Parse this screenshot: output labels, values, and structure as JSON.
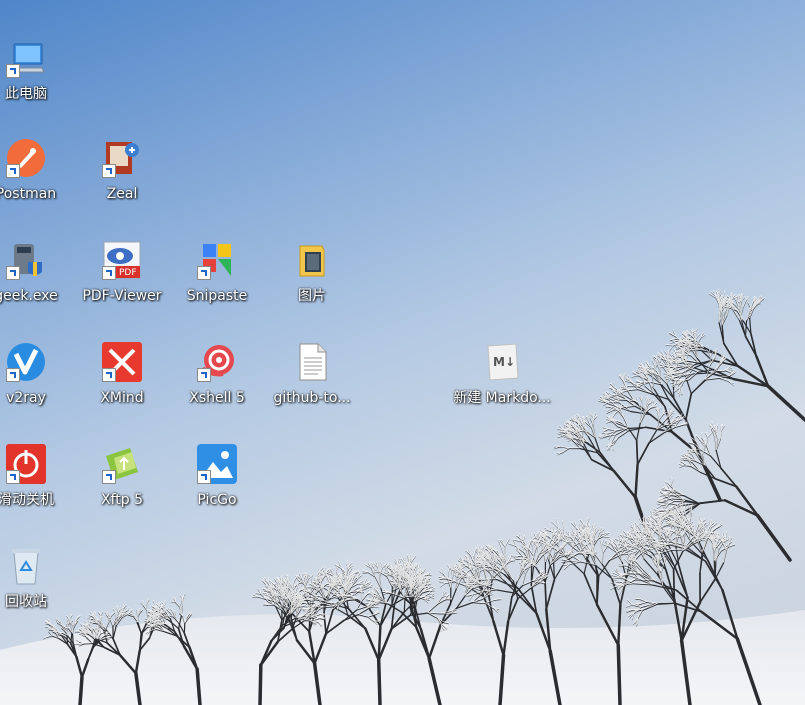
{
  "desktop": {
    "icons": [
      {
        "label": "此电脑",
        "icon": "computer-icon"
      },
      {
        "label": "Postman",
        "icon": "postman-icon"
      },
      {
        "label": "Zeal",
        "icon": "zeal-icon"
      },
      {
        "label": "geek.exe",
        "icon": "geek-icon"
      },
      {
        "label": "PDF-Viewer",
        "icon": "pdf-viewer-icon"
      },
      {
        "label": "Snipaste",
        "icon": "snipaste-icon"
      },
      {
        "label": "图片",
        "icon": "folder-icon"
      },
      {
        "label": "v2ray",
        "icon": "v2ray-icon"
      },
      {
        "label": "XMind",
        "icon": "xmind-icon"
      },
      {
        "label": "Xshell 5",
        "icon": "xshell-icon"
      },
      {
        "label": "github-to...",
        "icon": "text-file-icon"
      },
      {
        "label": "新建 Markdo...",
        "icon": "markdown-file-icon"
      },
      {
        "label": "滑动关机",
        "icon": "slide-shutdown-icon"
      },
      {
        "label": "Xftp 5",
        "icon": "xftp-icon"
      },
      {
        "label": "PicGo",
        "icon": "picgo-icon"
      },
      {
        "label": "回收站",
        "icon": "recycle-bin-icon"
      }
    ]
  },
  "colors": {
    "sky_top": "#4f86c9",
    "sky_bottom": "#d2dbe6",
    "label_text": "#ffffff"
  }
}
